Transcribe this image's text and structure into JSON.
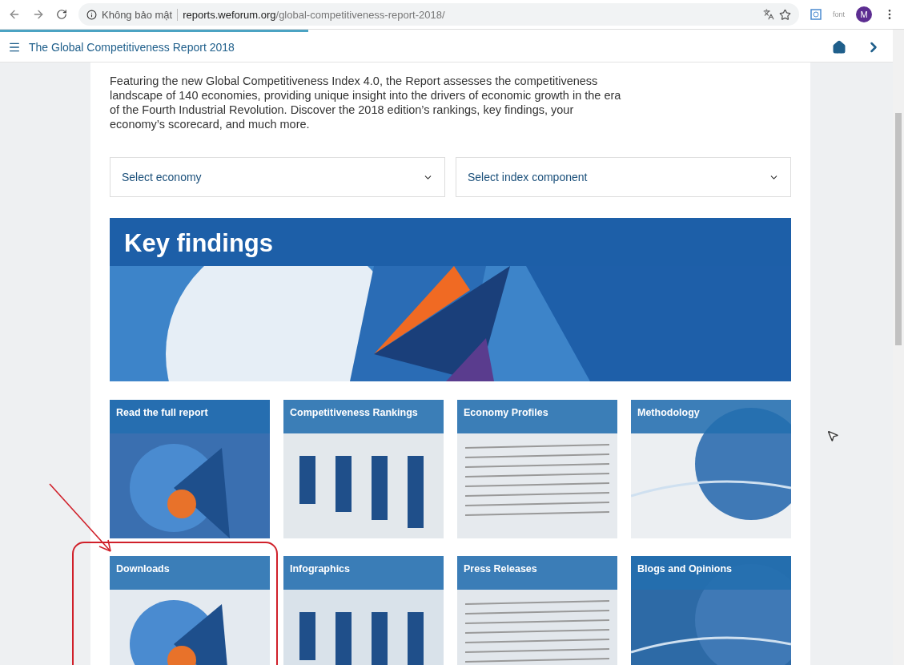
{
  "browser": {
    "security_label": "Không bảo mật",
    "url_host": "reports.weforum.org",
    "url_path": "/global-competitiveness-report-2018/",
    "extension_label": "font",
    "profile_initial": "M"
  },
  "page_load": {
    "level": 0.345
  },
  "site_header": {
    "title": "The Global Competitiveness Report 2018"
  },
  "intro": "Featuring the new Global Competitiveness Index 4.0, the Report assesses the competitiveness landscape of 140 economies, providing unique insight into the drivers of economic growth in the era of the Fourth Industrial Revolution. Discover the 2018 edition’s rankings, key findings, your economy’s scorecard, and much more.",
  "selects": [
    {
      "placeholder": "Select economy"
    },
    {
      "placeholder": "Select index component"
    }
  ],
  "banner": {
    "title": "Key findings"
  },
  "tiles": [
    {
      "title": "Read the full report"
    },
    {
      "title": "Competitiveness Rankings"
    },
    {
      "title": "Economy Profiles"
    },
    {
      "title": "Methodology"
    },
    {
      "title": "Downloads"
    },
    {
      "title": "Infographics"
    },
    {
      "title": "Press Releases"
    },
    {
      "title": "Blogs and Opinions"
    }
  ]
}
